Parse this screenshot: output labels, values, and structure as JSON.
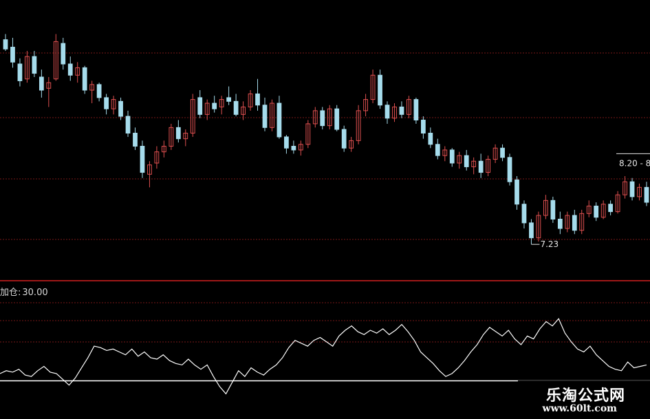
{
  "indicator": {
    "name": "加仓:",
    "value": "30.00"
  },
  "watermark": {
    "site_name": "乐淘公式网",
    "url": "www.60lt.com"
  },
  "colors": {
    "up": "#e05050",
    "down": "#a6dcec",
    "grid": "#7a1818",
    "separator": "#a01818",
    "indicator_line": "#ffffff",
    "baseline": "#ffffff"
  },
  "chart_data": [
    {
      "type": "candlestick",
      "title": "",
      "ylim": [
        6.9,
        9.55
      ],
      "annotations": [
        {
          "text": "7.23",
          "at_value": 7.23
        },
        {
          "text": "8.20 - 8",
          "at_value": 8.2
        }
      ],
      "candles_ohlc": [
        [
          9.42,
          9.48,
          9.3,
          9.32
        ],
        [
          9.34,
          9.44,
          9.12,
          9.18
        ],
        [
          9.16,
          9.22,
          8.92,
          8.98
        ],
        [
          9.0,
          9.3,
          8.96,
          9.24
        ],
        [
          9.24,
          9.3,
          9.02,
          9.06
        ],
        [
          9.02,
          9.1,
          8.8,
          8.88
        ],
        [
          8.9,
          9.02,
          8.7,
          8.96
        ],
        [
          9.0,
          9.48,
          8.98,
          9.4
        ],
        [
          9.38,
          9.44,
          9.1,
          9.16
        ],
        [
          9.16,
          9.24,
          8.98,
          9.04
        ],
        [
          9.04,
          9.18,
          8.96,
          9.12
        ],
        [
          9.12,
          9.14,
          8.84,
          8.88
        ],
        [
          8.88,
          8.98,
          8.74,
          8.94
        ],
        [
          8.94,
          8.96,
          8.76,
          8.8
        ],
        [
          8.8,
          8.84,
          8.62,
          8.68
        ],
        [
          8.68,
          8.82,
          8.62,
          8.78
        ],
        [
          8.76,
          8.8,
          8.56,
          8.6
        ],
        [
          8.6,
          8.66,
          8.38,
          8.42
        ],
        [
          8.42,
          8.48,
          8.24,
          8.28
        ],
        [
          8.28,
          8.34,
          7.94,
          8.0
        ],
        [
          7.98,
          8.12,
          7.84,
          8.08
        ],
        [
          8.1,
          8.28,
          8.04,
          8.22
        ],
        [
          8.22,
          8.34,
          8.16,
          8.28
        ],
        [
          8.28,
          8.52,
          8.24,
          8.48
        ],
        [
          8.48,
          8.56,
          8.32,
          8.36
        ],
        [
          8.36,
          8.46,
          8.28,
          8.42
        ],
        [
          8.42,
          8.84,
          8.38,
          8.78
        ],
        [
          8.8,
          8.88,
          8.58,
          8.62
        ],
        [
          8.62,
          8.78,
          8.56,
          8.74
        ],
        [
          8.74,
          8.82,
          8.64,
          8.68
        ],
        [
          8.7,
          8.82,
          8.62,
          8.78
        ],
        [
          8.8,
          8.92,
          8.72,
          8.76
        ],
        [
          8.76,
          8.84,
          8.6,
          8.62
        ],
        [
          8.62,
          8.76,
          8.56,
          8.7
        ],
        [
          8.7,
          8.88,
          8.66,
          8.84
        ],
        [
          8.84,
          9.0,
          8.66,
          8.72
        ],
        [
          8.72,
          8.8,
          8.44,
          8.48
        ],
        [
          8.48,
          8.78,
          8.44,
          8.74
        ],
        [
          8.74,
          8.82,
          8.36,
          8.38
        ],
        [
          8.38,
          8.4,
          8.2,
          8.26
        ],
        [
          8.28,
          8.34,
          8.2,
          8.24
        ],
        [
          8.24,
          8.34,
          8.18,
          8.3
        ],
        [
          8.3,
          8.56,
          8.26,
          8.52
        ],
        [
          8.52,
          8.7,
          8.48,
          8.66
        ],
        [
          8.66,
          8.7,
          8.46,
          8.5
        ],
        [
          8.5,
          8.72,
          8.46,
          8.68
        ],
        [
          8.68,
          8.72,
          8.44,
          8.46
        ],
        [
          8.46,
          8.5,
          8.22,
          8.26
        ],
        [
          8.26,
          8.38,
          8.22,
          8.34
        ],
        [
          8.34,
          8.72,
          8.3,
          8.66
        ],
        [
          8.66,
          8.84,
          8.6,
          8.78
        ],
        [
          8.78,
          9.1,
          8.74,
          9.04
        ],
        [
          9.04,
          9.1,
          8.68,
          8.72
        ],
        [
          8.72,
          8.76,
          8.52,
          8.58
        ],
        [
          8.58,
          8.74,
          8.54,
          8.7
        ],
        [
          8.7,
          8.76,
          8.58,
          8.62
        ],
        [
          8.62,
          8.82,
          8.58,
          8.78
        ],
        [
          8.78,
          8.8,
          8.52,
          8.56
        ],
        [
          8.56,
          8.6,
          8.36,
          8.42
        ],
        [
          8.42,
          8.48,
          8.26,
          8.3
        ],
        [
          8.3,
          8.36,
          8.14,
          8.18
        ],
        [
          8.18,
          8.28,
          8.12,
          8.24
        ],
        [
          8.24,
          8.26,
          8.06,
          8.1
        ],
        [
          8.1,
          8.22,
          8.04,
          8.18
        ],
        [
          8.18,
          8.24,
          8.02,
          8.06
        ],
        [
          8.06,
          8.16,
          7.98,
          8.12
        ],
        [
          8.12,
          8.2,
          7.94,
          8.0
        ],
        [
          8.0,
          8.18,
          7.96,
          8.14
        ],
        [
          8.14,
          8.3,
          8.1,
          8.26
        ],
        [
          8.26,
          8.3,
          8.12,
          8.16
        ],
        [
          8.16,
          8.2,
          7.86,
          7.9
        ],
        [
          7.92,
          7.96,
          7.6,
          7.66
        ],
        [
          7.66,
          7.7,
          7.4,
          7.46
        ],
        [
          7.46,
          7.5,
          7.23,
          7.3
        ],
        [
          7.3,
          7.58,
          7.26,
          7.54
        ],
        [
          7.54,
          7.76,
          7.5,
          7.7
        ],
        [
          7.7,
          7.74,
          7.46,
          7.5
        ],
        [
          7.5,
          7.58,
          7.34,
          7.4
        ],
        [
          7.4,
          7.58,
          7.36,
          7.54
        ],
        [
          7.54,
          7.6,
          7.34,
          7.38
        ],
        [
          7.38,
          7.6,
          7.34,
          7.56
        ],
        [
          7.56,
          7.7,
          7.52,
          7.64
        ],
        [
          7.64,
          7.68,
          7.48,
          7.52
        ],
        [
          7.52,
          7.7,
          7.5,
          7.66
        ],
        [
          7.66,
          7.7,
          7.54,
          7.58
        ],
        [
          7.58,
          7.8,
          7.56,
          7.76
        ],
        [
          7.76,
          7.96,
          7.72,
          7.9
        ],
        [
          7.9,
          7.94,
          7.7,
          7.74
        ],
        [
          7.74,
          7.88,
          7.7,
          7.84
        ],
        [
          7.84,
          7.9,
          7.64,
          7.68
        ]
      ]
    },
    {
      "type": "line",
      "title": "",
      "ylim": [
        0,
        140
      ],
      "reference_line": 30,
      "series": [
        {
          "values": [
            40,
            44,
            42,
            46,
            38,
            36,
            44,
            50,
            42,
            40,
            32,
            24,
            34,
            48,
            62,
            78,
            76,
            72,
            74,
            70,
            66,
            74,
            64,
            70,
            62,
            60,
            66,
            58,
            54,
            52,
            60,
            52,
            46,
            52,
            36,
            22,
            12,
            28,
            44,
            36,
            48,
            42,
            38,
            46,
            52,
            62,
            76,
            86,
            82,
            78,
            86,
            90,
            84,
            78,
            92,
            100,
            106,
            98,
            94,
            100,
            96,
            102,
            94,
            100,
            108,
            98,
            86,
            70,
            62,
            54,
            44,
            36,
            40,
            48,
            58,
            70,
            80,
            94,
            104,
            98,
            92,
            100,
            88,
            80,
            92,
            88,
            102,
            112,
            106,
            116,
            96,
            84,
            74,
            70,
            78,
            66,
            58,
            50,
            46,
            44,
            56,
            48,
            50,
            52
          ]
        }
      ]
    }
  ]
}
